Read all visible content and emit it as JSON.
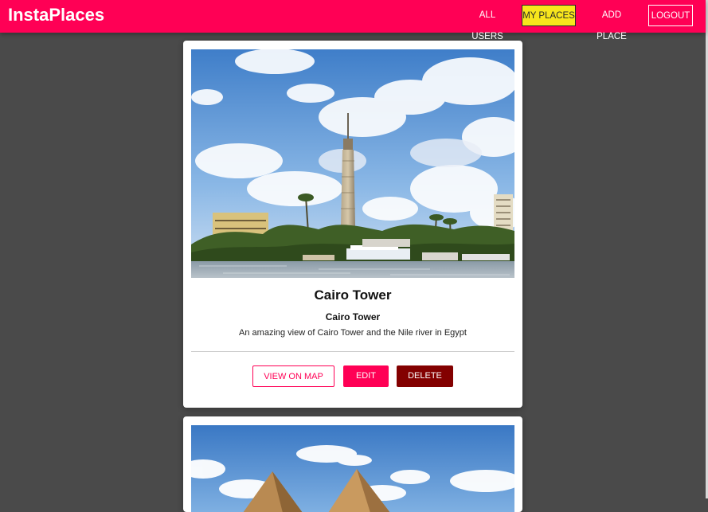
{
  "header": {
    "brand": "InstaPlaces",
    "nav": {
      "all_users": "ALL USERS",
      "my_places": "MY PLACES",
      "add_place": "ADD PLACE",
      "logout": "LOGOUT"
    }
  },
  "places": [
    {
      "title": "Cairo Tower",
      "address": "Cairo Tower",
      "description": "An amazing view of Cairo Tower and the Nile river in Egypt",
      "buttons": {
        "view_on_map": "VIEW ON MAP",
        "edit": "EDIT",
        "delete": "DELETE"
      }
    }
  ],
  "colors": {
    "brand": "#ff0055",
    "active_nav": "#f7e51c",
    "delete": "#830000",
    "background": "#4a4a4a"
  }
}
